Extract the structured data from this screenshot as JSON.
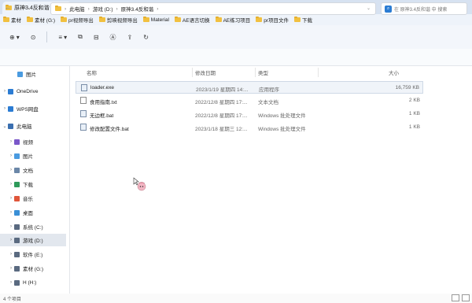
{
  "tab": {
    "title": "原神3.4反和谐"
  },
  "window": {
    "tab_count": "1"
  },
  "bookmarks": [
    "素材",
    "素材 (G:)",
    "pr视频导出",
    "剪映视频导出",
    "Material",
    "AE语言切换",
    "AE练习项目",
    "pr项目文件",
    "下载"
  ],
  "toolbar": {
    "items": [
      {
        "icon": "new-icon",
        "label": "⊕"
      },
      {
        "icon": "history-icon",
        "label": "⊙"
      },
      {
        "icon": "view-icon",
        "label": "≡"
      },
      {
        "icon": "copy-icon",
        "label": "⧉"
      },
      {
        "icon": "paste-icon",
        "label": "⊟"
      },
      {
        "icon": "rename-icon",
        "label": "Ⓐ"
      },
      {
        "icon": "share-icon",
        "label": "⇪"
      },
      {
        "icon": "refresh-icon",
        "label": "↻"
      }
    ]
  },
  "address": {
    "crumbs": [
      "此电脑",
      "游戏 (D:)",
      "原神3.4反和谐"
    ]
  },
  "search": {
    "placeholder": "在 原神3.4反和谐 中 搜索"
  },
  "sidebar": {
    "items": [
      {
        "label": "图片",
        "icon": "pictures-icon",
        "color": "#4a9be0",
        "chev": ""
      },
      {
        "label": "OneDrive",
        "icon": "onedrive-icon",
        "color": "#2b7cd3",
        "chev": ">"
      },
      {
        "label": "WPS网盘",
        "icon": "cloud-icon",
        "color": "#2b7cd3",
        "chev": ">"
      },
      {
        "label": "此电脑",
        "icon": "pc-icon",
        "color": "#3a6fb0",
        "chev": "v"
      },
      {
        "label": "视频",
        "icon": "videos-icon",
        "color": "#7a57c9",
        "chev": ">"
      },
      {
        "label": "图片",
        "icon": "pictures-icon",
        "color": "#4a9be0",
        "chev": ">"
      },
      {
        "label": "文档",
        "icon": "documents-icon",
        "color": "#6b87a8",
        "chev": ">"
      },
      {
        "label": "下载",
        "icon": "downloads-icon",
        "color": "#2e9a5a",
        "chev": ">"
      },
      {
        "label": "音乐",
        "icon": "music-icon",
        "color": "#e0563a",
        "chev": ">"
      },
      {
        "label": "桌面",
        "icon": "desktop-icon",
        "color": "#3a8fd6",
        "chev": ">"
      },
      {
        "label": "系统 (C:)",
        "icon": "drive-icon",
        "color": "#5a6a80",
        "chev": ">"
      },
      {
        "label": "游戏 (D:)",
        "icon": "drive-icon",
        "color": "#5a6a80",
        "chev": ">"
      },
      {
        "label": "软件 (E:)",
        "icon": "drive-icon",
        "color": "#5a6a80",
        "chev": ">"
      },
      {
        "label": "素材 (G:)",
        "icon": "drive-icon",
        "color": "#5a6a80",
        "chev": ">"
      },
      {
        "label": "H (H:)",
        "icon": "drive-icon",
        "color": "#5a6a80",
        "chev": ">"
      }
    ]
  },
  "columns": {
    "name": "名称",
    "modified": "修改日期",
    "type": "类型",
    "size": "大小"
  },
  "files": [
    {
      "name": "loader.exe",
      "modified": "2023/1/19 星期四 14:...",
      "type": "应用程序",
      "size": "16,759 KB",
      "icon": "exe-icon"
    },
    {
      "name": "食用指南.txt",
      "modified": "2022/12/8 星期四 17:...",
      "type": "文本文档",
      "size": "2 KB",
      "icon": "txt-icon"
    },
    {
      "name": "无边框.bat",
      "modified": "2022/12/8 星期四 17:...",
      "type": "Windows 批处理文件",
      "size": "1 KB",
      "icon": "bat-icon"
    },
    {
      "name": "修改配置文件.bat",
      "modified": "2023/1/18 星期三 12:...",
      "type": "Windows 批处理文件",
      "size": "1 KB",
      "icon": "bat-icon"
    }
  ],
  "status": {
    "count": "4 个项目"
  }
}
